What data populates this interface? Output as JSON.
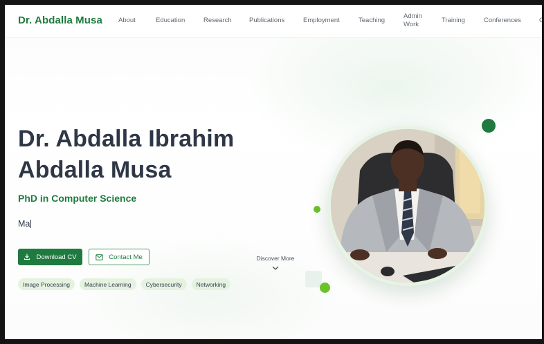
{
  "nav": {
    "brand": "Dr. Abdalla Musa",
    "links": [
      "About",
      "Education",
      "Research",
      "Publications",
      "Employment",
      "Teaching",
      "Admin Work",
      "Training",
      "Conferences"
    ],
    "overflow_fragment": "C"
  },
  "hero": {
    "title_line1": "Dr. Abdalla Ibrahim",
    "title_line2": "Abdalla Musa",
    "subtitle": "PhD in Computer Science",
    "typed_text": "Ma",
    "download_button": "Download CV",
    "contact_button": "Contact Me",
    "tags": [
      "Image Processing",
      "Machine Learning",
      "Cybersecurity",
      "Networking"
    ],
    "discover": "Discover More"
  },
  "colors": {
    "brand": "#1f7a3f",
    "accent_green": "#6cc22a",
    "title_dark": "#2f3747",
    "tag_bg": "#e4f2df"
  },
  "icons": {
    "download": "download-icon",
    "contact": "mail-icon",
    "discover": "chevron-down-icon"
  }
}
